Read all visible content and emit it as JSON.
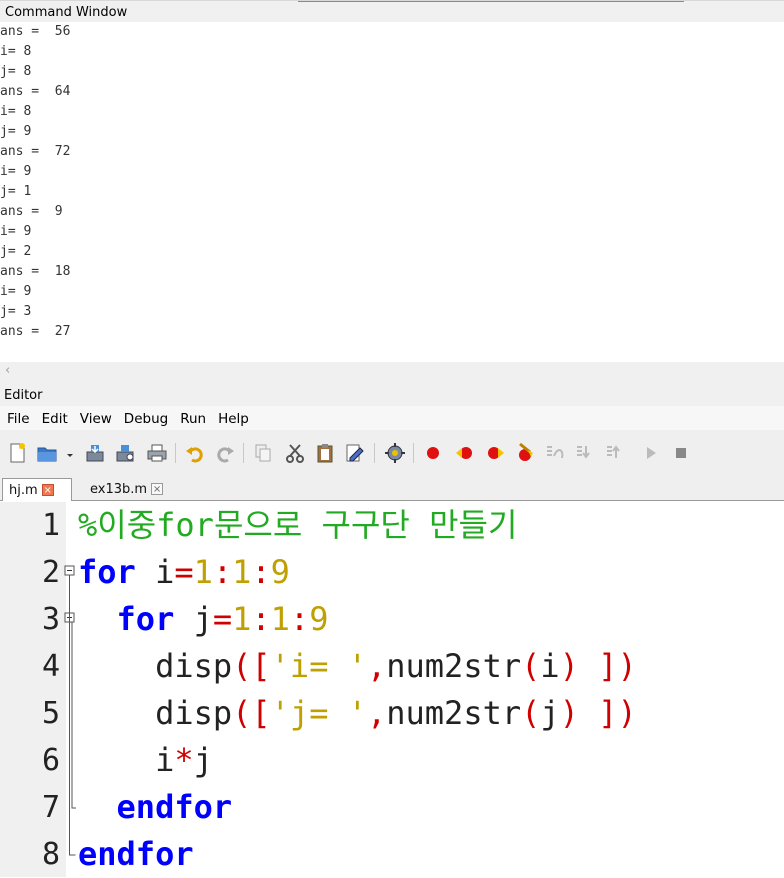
{
  "command_window": {
    "title": "Command Window",
    "lines": [
      "ans =  56",
      "i= 8",
      "j= 8",
      "ans =  64",
      "i= 8",
      "j= 9",
      "ans =  72",
      "i= 9",
      "j= 1",
      "ans =  9",
      "i= 9",
      "j= 2",
      "ans =  18",
      "i= 9",
      "j= 3",
      "ans =  27"
    ]
  },
  "scroll_arrow": "‹",
  "editor": {
    "title": "Editor",
    "menu": [
      "File",
      "Edit",
      "View",
      "Debug",
      "Run",
      "Help"
    ],
    "tabs": [
      {
        "label": "hj.m",
        "active": true
      },
      {
        "label": "ex13b.m",
        "active": false
      }
    ],
    "line_numbers": [
      "1",
      "2",
      "3",
      "4",
      "5",
      "6",
      "7",
      "8"
    ],
    "code": {
      "l1": {
        "comment": "%이중for문으로 구구단 만들기"
      },
      "l2": {
        "kw": "for",
        "sp": " ",
        "var": "i",
        "eq": "=",
        "n1": "1",
        "c1": ":",
        "n2": "1",
        "c2": ":",
        "n3": "9"
      },
      "l3": {
        "indent": "  ",
        "kw": "for",
        "sp": " ",
        "var": "j",
        "eq": "=",
        "n1": "1",
        "c1": ":",
        "n2": "1",
        "c2": ":",
        "n3": "9"
      },
      "l4": {
        "indent": "    ",
        "fn": "disp",
        "p1": "(",
        "b1": "[",
        "str": "'i= '",
        "comma": ",",
        "fn2": "num2str",
        "p2": "(",
        "arg": "i",
        "p3": ")",
        "sp": " ",
        "b2": "]",
        "p4": ")"
      },
      "l5": {
        "indent": "    ",
        "fn": "disp",
        "p1": "(",
        "b1": "[",
        "str": "'j= '",
        "comma": ",",
        "fn2": "num2str",
        "p2": "(",
        "arg": "j",
        "p3": ")",
        "sp": " ",
        "b2": "]",
        "p4": ")"
      },
      "l6": {
        "indent": "    ",
        "a": "i",
        "op": "*",
        "b": "j"
      },
      "l7": {
        "indent": "  ",
        "kw": "endfor"
      },
      "l8": {
        "kw": "endfor"
      }
    }
  },
  "colors": {
    "keyword": "#0000ff",
    "comment": "#22aa22",
    "number": "#c0a000",
    "operator": "#d00000",
    "breakpoint": "#e01010"
  },
  "toolbar_icons": [
    "new-file-icon",
    "open-folder-icon",
    "save-icon",
    "save-as-icon",
    "print-icon",
    "undo-icon",
    "redo-icon",
    "copy-icon",
    "cut-icon",
    "paste-icon",
    "find-icon",
    "settings-icon",
    "breakpoint-icon",
    "prev-breakpoint-icon",
    "next-breakpoint-icon",
    "clear-breakpoints-icon",
    "step-icon",
    "step-in-icon",
    "step-out-icon",
    "continue-icon",
    "stop-icon"
  ]
}
